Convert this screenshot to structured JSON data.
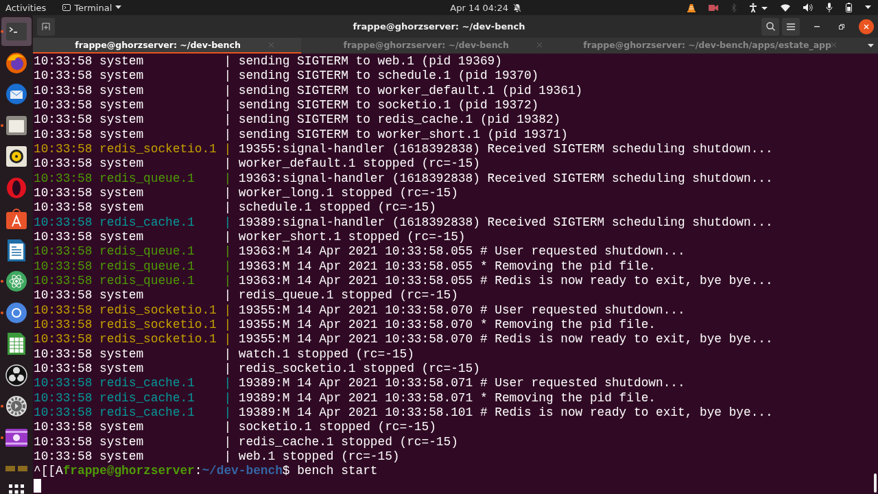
{
  "top_bar": {
    "activities": "Activities",
    "app_menu": "Terminal",
    "clock": "Apr 14  04:24"
  },
  "dock": [
    {
      "kind": "terminal",
      "selected": true,
      "running": true
    },
    {
      "kind": "browser",
      "selected": false,
      "running": false
    },
    {
      "kind": "mail",
      "selected": false,
      "running": false
    },
    {
      "kind": "folder",
      "selected": false,
      "running": true
    },
    {
      "kind": "speaker",
      "selected": false,
      "running": false
    },
    {
      "kind": "ring",
      "selected": false,
      "running": false
    },
    {
      "kind": "store",
      "selected": false,
      "running": false
    },
    {
      "kind": "document",
      "selected": false,
      "running": false
    },
    {
      "kind": "atom",
      "selected": false,
      "running": true
    },
    {
      "kind": "chrome",
      "selected": false,
      "running": true
    },
    {
      "kind": "sheet",
      "selected": false,
      "running": false
    },
    {
      "kind": "aperture",
      "selected": false,
      "running": false
    },
    {
      "kind": "settings",
      "selected": false,
      "running": true
    },
    {
      "kind": "video",
      "selected": false,
      "running": true
    },
    {
      "kind": "partial",
      "selected": false,
      "running": false
    }
  ],
  "window": {
    "title": "frappe@ghorzserver: ~/dev-bench"
  },
  "tabs": [
    {
      "label": "frappe@ghorzserver: ~/dev-bench",
      "selected": true
    },
    {
      "label": "frappe@ghorzserver: ~/dev-bench",
      "selected": false
    },
    {
      "label": "frappe@ghorzserver: ~/dev-bench/apps/estate_app",
      "selected": false
    }
  ],
  "log": [
    {
      "time": "10:33:58",
      "process": "system",
      "sep": "|",
      "message": "sending SIGTERM to web.1 (pid 19369)",
      "color": "#ffffff"
    },
    {
      "time": "10:33:58",
      "process": "system",
      "sep": "|",
      "message": "sending SIGTERM to schedule.1 (pid 19370)",
      "color": "#ffffff"
    },
    {
      "time": "10:33:58",
      "process": "system",
      "sep": "|",
      "message": "sending SIGTERM to worker_default.1 (pid 19361)",
      "color": "#ffffff"
    },
    {
      "time": "10:33:58",
      "process": "system",
      "sep": "|",
      "message": "sending SIGTERM to socketio.1 (pid 19372)",
      "color": "#ffffff"
    },
    {
      "time": "10:33:58",
      "process": "system",
      "sep": "|",
      "message": "sending SIGTERM to redis_cache.1 (pid 19382)",
      "color": "#ffffff"
    },
    {
      "time": "10:33:58",
      "process": "system",
      "sep": "|",
      "message": "sending SIGTERM to worker_short.1 (pid 19371)",
      "color": "#ffffff"
    },
    {
      "time": "10:33:58",
      "process": "redis_socketio.1",
      "sep": "|",
      "message": "19355:signal-handler (1618392838) Received SIGTERM scheduling shutdown...",
      "color": "#c4a000"
    },
    {
      "time": "10:33:58",
      "process": "system",
      "sep": "|",
      "message": "worker_default.1 stopped (rc=-15)",
      "color": "#ffffff"
    },
    {
      "time": "10:33:58",
      "process": "redis_queue.1",
      "sep": "|",
      "message": "19363:signal-handler (1618392838) Received SIGTERM scheduling shutdown...",
      "color": "#4e9a06"
    },
    {
      "time": "10:33:58",
      "process": "system",
      "sep": "|",
      "message": "worker_long.1 stopped (rc=-15)",
      "color": "#ffffff"
    },
    {
      "time": "10:33:58",
      "process": "system",
      "sep": "|",
      "message": "schedule.1 stopped (rc=-15)",
      "color": "#ffffff"
    },
    {
      "time": "10:33:58",
      "process": "redis_cache.1",
      "sep": "|",
      "message": "19389:signal-handler (1618392838) Received SIGTERM scheduling shutdown...",
      "color": "#06989a"
    },
    {
      "time": "10:33:58",
      "process": "system",
      "sep": "|",
      "message": "worker_short.1 stopped (rc=-15)",
      "color": "#ffffff"
    },
    {
      "time": "10:33:58",
      "process": "redis_queue.1",
      "sep": "|",
      "message": "19363:M 14 Apr 2021 10:33:58.055 # User requested shutdown...",
      "color": "#4e9a06"
    },
    {
      "time": "10:33:58",
      "process": "redis_queue.1",
      "sep": "|",
      "message": "19363:M 14 Apr 2021 10:33:58.055 * Removing the pid file.",
      "color": "#4e9a06"
    },
    {
      "time": "10:33:58",
      "process": "redis_queue.1",
      "sep": "|",
      "message": "19363:M 14 Apr 2021 10:33:58.055 # Redis is now ready to exit, bye bye...",
      "color": "#4e9a06"
    },
    {
      "time": "10:33:58",
      "process": "system",
      "sep": "|",
      "message": "redis_queue.1 stopped (rc=-15)",
      "color": "#ffffff"
    },
    {
      "time": "10:33:58",
      "process": "redis_socketio.1",
      "sep": "|",
      "message": "19355:M 14 Apr 2021 10:33:58.070 # User requested shutdown...",
      "color": "#c4a000"
    },
    {
      "time": "10:33:58",
      "process": "redis_socketio.1",
      "sep": "|",
      "message": "19355:M 14 Apr 2021 10:33:58.070 * Removing the pid file.",
      "color": "#c4a000"
    },
    {
      "time": "10:33:58",
      "process": "redis_socketio.1",
      "sep": "|",
      "message": "19355:M 14 Apr 2021 10:33:58.070 # Redis is now ready to exit, bye bye...",
      "color": "#c4a000"
    },
    {
      "time": "10:33:58",
      "process": "system",
      "sep": "|",
      "message": "watch.1 stopped (rc=-15)",
      "color": "#ffffff"
    },
    {
      "time": "10:33:58",
      "process": "system",
      "sep": "|",
      "message": "redis_socketio.1 stopped (rc=-15)",
      "color": "#ffffff"
    },
    {
      "time": "10:33:58",
      "process": "redis_cache.1",
      "sep": "|",
      "message": "19389:M 14 Apr 2021 10:33:58.071 # User requested shutdown...",
      "color": "#06989a"
    },
    {
      "time": "10:33:58",
      "process": "redis_cache.1",
      "sep": "|",
      "message": "19389:M 14 Apr 2021 10:33:58.071 * Removing the pid file.",
      "color": "#06989a"
    },
    {
      "time": "10:33:58",
      "process": "redis_cache.1",
      "sep": "|",
      "message": "19389:M 14 Apr 2021 10:33:58.101 # Redis is now ready to exit, bye bye...",
      "color": "#06989a"
    },
    {
      "time": "10:33:58",
      "process": "system",
      "sep": "|",
      "message": "socketio.1 stopped (rc=-15)",
      "color": "#ffffff"
    },
    {
      "time": "10:33:58",
      "process": "system",
      "sep": "|",
      "message": "redis_cache.1 stopped (rc=-15)",
      "color": "#ffffff"
    },
    {
      "time": "10:33:58",
      "process": "system",
      "sep": "|",
      "message": "web.1 stopped (rc=-15)",
      "color": "#ffffff"
    }
  ],
  "prompt": {
    "escape": "^[[A",
    "user_host": "frappe@ghorzserver",
    "colon": ":",
    "path": "~/dev-bench",
    "command": "$ bench start"
  }
}
